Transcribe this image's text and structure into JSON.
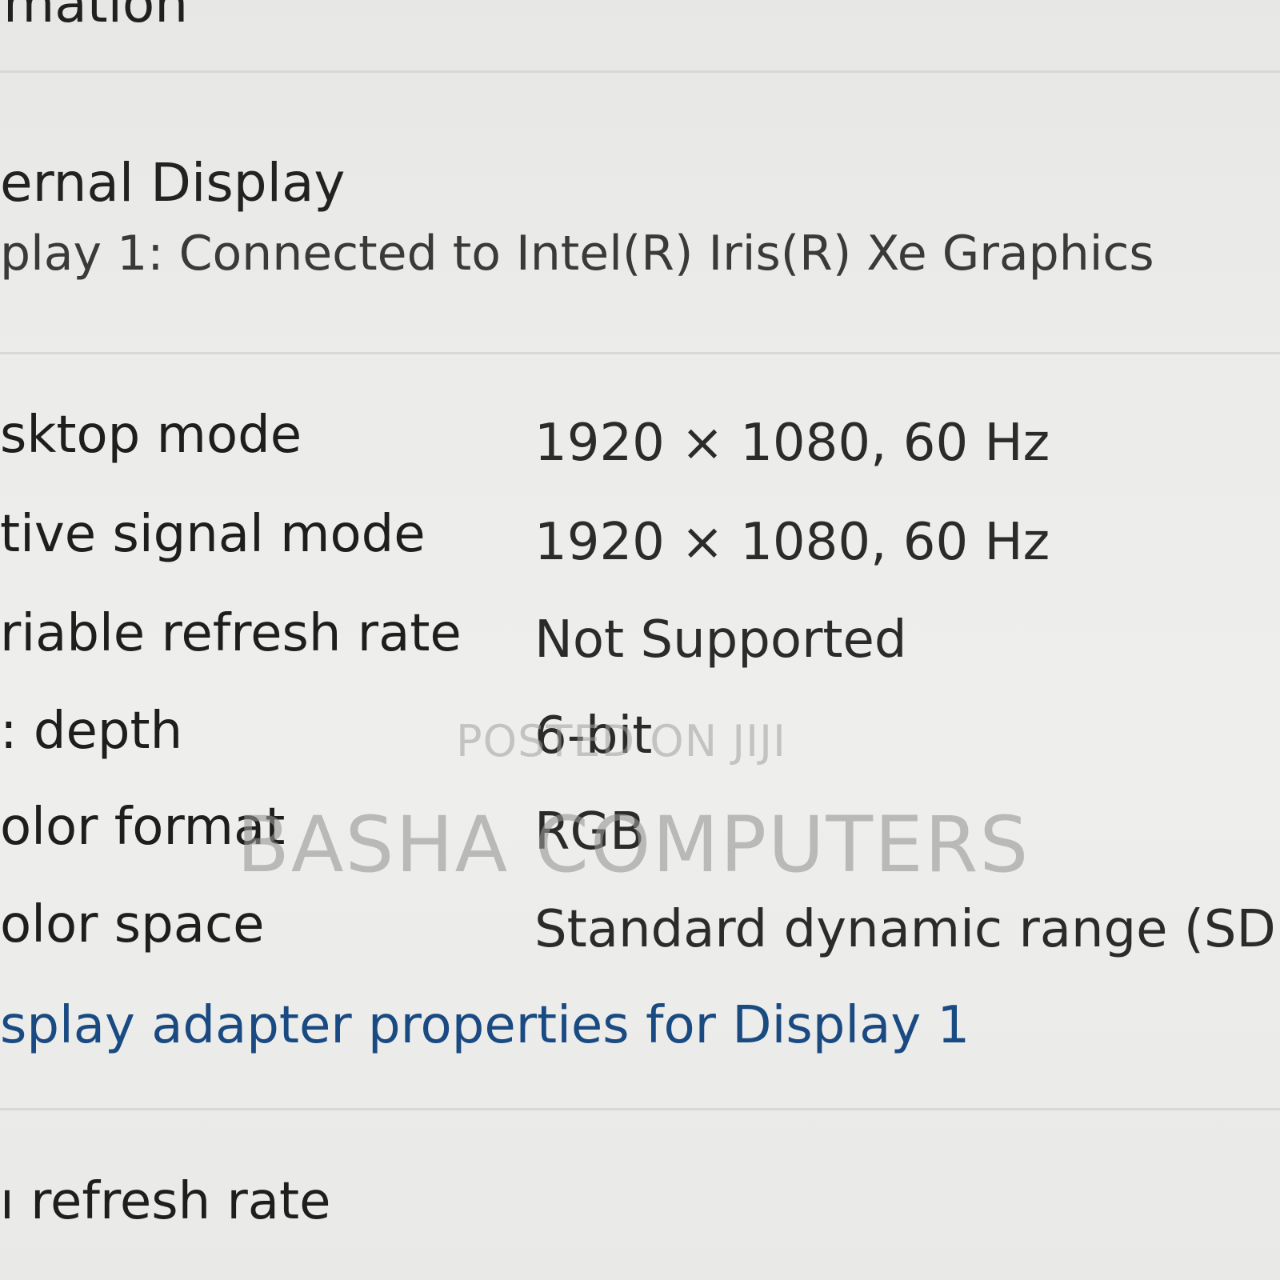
{
  "header": {
    "section_title": "rmation"
  },
  "display": {
    "name": "ernal Display",
    "subtitle": "play 1: Connected to Intel(R) Iris(R) Xe Graphics"
  },
  "properties": [
    {
      "label": "sktop mode",
      "value": "1920 × 1080, 60 Hz"
    },
    {
      "label": "tive signal mode",
      "value": "1920 × 1080, 60 Hz"
    },
    {
      "label": "riable refresh rate",
      "value": "Not Supported"
    },
    {
      "label": ": depth",
      "value": "6-bit"
    },
    {
      "label": "olor format",
      "value": "RGB"
    },
    {
      "label": "olor space",
      "value": "Standard dynamic range (SDR)"
    }
  ],
  "adapter_link": "splay adapter properties for Display 1",
  "refresh_section_title": "ı refresh rate",
  "watermark": {
    "line1": "POSTED ON JIJI",
    "line2": "BASHA COMPUTERS"
  }
}
